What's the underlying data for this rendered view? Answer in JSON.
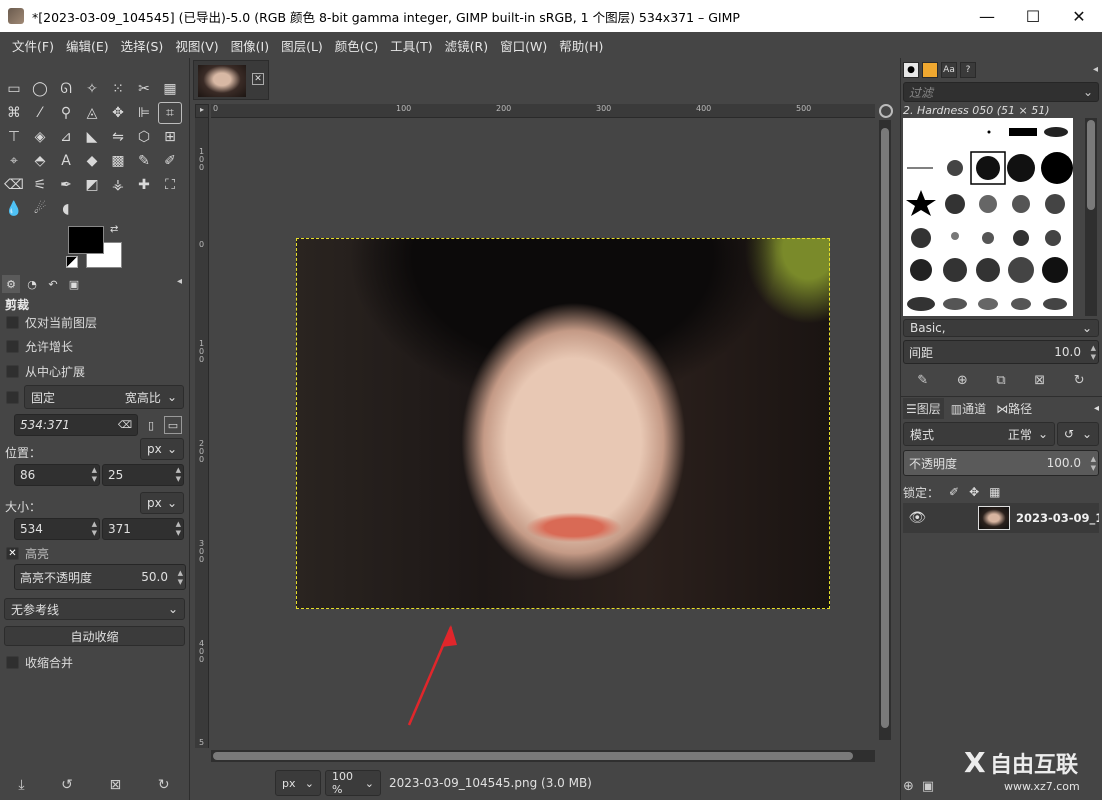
{
  "window": {
    "title": "*[2023-03-09_104545] (已导出)-5.0 (RGB 颜色 8-bit gamma integer, GIMP built-in sRGB, 1 个图层) 534x371 – GIMP",
    "minimize": "—",
    "maximize": "☐",
    "close": "✕"
  },
  "menu": [
    "文件(F)",
    "编辑(E)",
    "选择(S)",
    "视图(V)",
    "图像(I)",
    "图层(L)",
    "颜色(C)",
    "工具(T)",
    "滤镜(R)",
    "窗口(W)",
    "帮助(H)"
  ],
  "tool_options": {
    "title": "剪裁",
    "current_layer_only": "仅对当前图层",
    "allow_growing": "允许增长",
    "expand_from_center": "从中心扩展",
    "fixed_label": "固定",
    "fixed_mode": "宽高比",
    "ratio_value": "534:371",
    "position_label": "位置：",
    "position_unit": "px",
    "position_x": "86",
    "position_y": "25",
    "size_label": "大小：",
    "size_unit": "px",
    "size_w": "534",
    "size_h": "371",
    "highlight_label": "高亮",
    "highlight_opacity_label": "高亮不透明度",
    "highlight_opacity_value": "50.0",
    "guides": "无参考线",
    "auto_shrink": "自动收缩",
    "shrink_merged": "收缩合并"
  },
  "rulers": {
    "h_ticks": [
      "0",
      "100",
      "200",
      "300",
      "400",
      "500"
    ],
    "v_ticks": [
      "1\n0\n0",
      "0",
      "1\n0\n0",
      "2\n0\n0",
      "3\n0\n0",
      "4\n0\n0",
      "5"
    ]
  },
  "statusbar": {
    "unit": "px",
    "zoom": "100 %",
    "file_info": "2023-03-09_104545.png (3.0 MB)"
  },
  "brushes": {
    "filter_placeholder": "过滤",
    "current_brush": "2. Hardness 050 (51 × 51)",
    "preset": "Basic,",
    "spacing_label": "间距",
    "spacing_value": "10.0"
  },
  "layers": {
    "tab_layers": "图层",
    "tab_channels": "通道",
    "tab_paths": "路径",
    "mode_label": "模式",
    "mode_value": "正常",
    "opacity_label": "不透明度",
    "opacity_value": "100.0",
    "lock_label": "锁定：",
    "layer_name": "2023-03-09_1"
  },
  "watermark": {
    "text": "自由互联",
    "url": "www.xz7.com"
  },
  "colors": {
    "accent": "#e8e02a",
    "annotation_arrow": "#e0262b"
  }
}
